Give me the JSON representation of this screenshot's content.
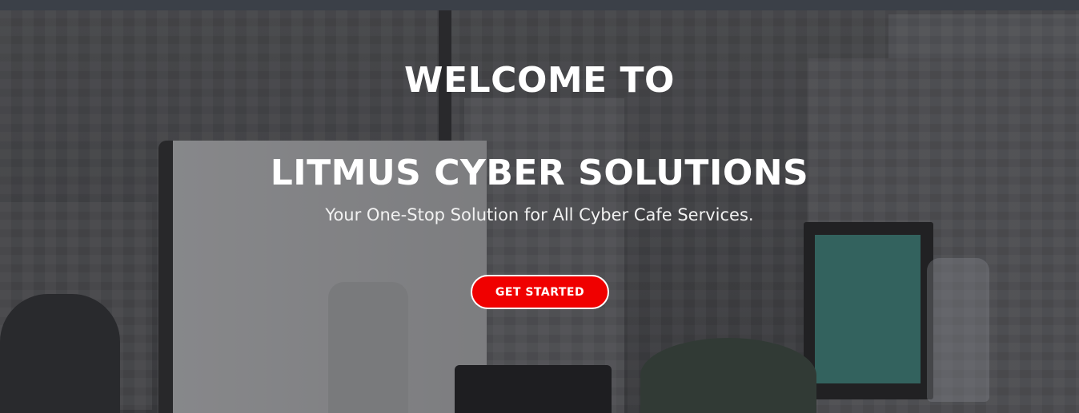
{
  "hero": {
    "title_line1": "WELCOME TO",
    "title_line2": "LITMUS CYBER SOLUTIONS",
    "subtitle": "Your One-Stop Solution for All Cyber Cafe Services.",
    "cta_label": "GET STARTED"
  },
  "colors": {
    "cta_background": "#f00000",
    "topbar": "#3b4048",
    "text": "#ffffff"
  }
}
